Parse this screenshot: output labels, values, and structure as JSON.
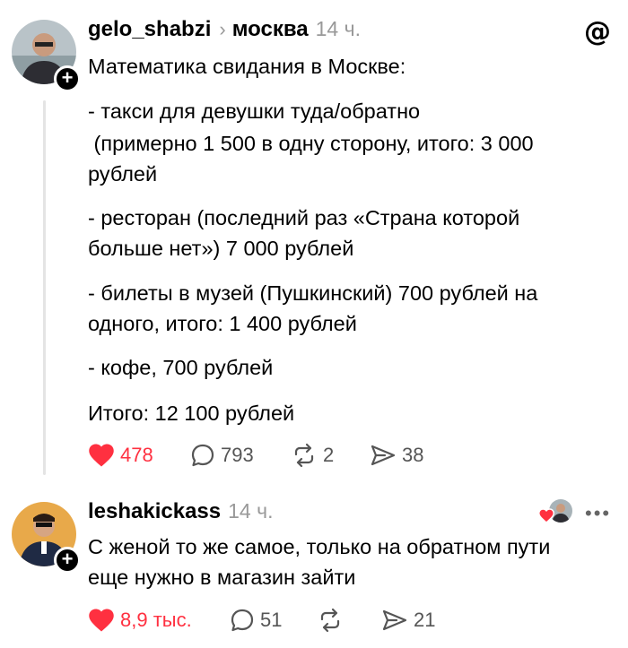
{
  "post": {
    "username": "gelo_shabzi",
    "topic": "москва",
    "time": "14 ч.",
    "paragraphs": [
      "Математика свидания в Москве:",
      "- такси для девушки туда/обратно",
      " (примерно 1 500 в одну сторону, итого: 3 000",
      "рублей",
      "- ресторан (последний раз «Страна которой",
      "больше нет») 7 000 рублей",
      "- билеты в музей (Пушкинский) 700 рублей на",
      "одного, итого: 1 400 рублей",
      "- кофе, 700 рублей",
      "Итого: 12 100 рублей"
    ],
    "likes": "478",
    "comments": "793",
    "reposts": "2",
    "shares": "38"
  },
  "reply": {
    "username": "leshakickass",
    "time": "14 ч.",
    "paragraphs": [
      "С женой то же самое, только на обратном пути",
      "еще нужно в магазин зайти"
    ],
    "likes": "8,9 тыс.",
    "comments": "51",
    "shares": "21"
  },
  "icons": {
    "threads_logo": "threads-logo-icon",
    "follow": "plus-icon",
    "like": "heart-icon",
    "comment": "comment-bubble-icon",
    "repost": "repost-icon",
    "share": "share-send-icon",
    "more": "more-dots-icon"
  },
  "colors": {
    "like": "#ff3040",
    "meta": "#999999",
    "action": "#555555"
  }
}
